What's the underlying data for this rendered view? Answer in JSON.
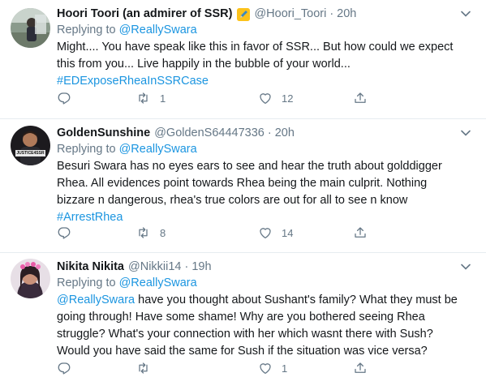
{
  "tweets": [
    {
      "name": "Hoori Toori (an admirer of SSR)",
      "has_badge": true,
      "handle": "@Hoori_Toori",
      "time": "20h",
      "replying_label": "Replying to",
      "replying_to": "@ReallySwara",
      "lines": [
        "Might.... You have speak like this in favor of SSR... But how could we  expect",
        "this from you... Live happily in the bubble of your world..."
      ],
      "hashtag": "#EDExposeRheaInSSRCase",
      "retweets": "1",
      "likes": "12",
      "avatar_icon": "person-photo-icon"
    },
    {
      "name": "GoldenSunshine",
      "handle": "@GoldenS64447336",
      "time": "20h",
      "replying_label": "Replying to",
      "replying_to": "@ReallySwara",
      "lines": [
        "Besuri Swara has no eyes ears to see and hear the truth about golddigger",
        "Rhea.  All evidences point towards Rhea being the main culprit.  Nothing",
        "bizzare n dangerous, rhea's true colors are out for all to see n know"
      ],
      "hashtag": "#ArrestRhea",
      "avatar_text": "JUSTICE4SSR",
      "retweets": "8",
      "likes": "14"
    },
    {
      "name": "Nikita Nikita",
      "handle": "@Nikkii14",
      "time": "19h",
      "replying_label": "Replying to",
      "replying_to": "@ReallySwara",
      "mention": "@ReallySwara",
      "first_line_rest": " have you thought about Sushant's family? What they must be",
      "lines": [
        "going through! Have some shame! Why are you bothered seeing Rhea",
        "struggle? What's your connection with her which wasnt there with Sush?",
        "Would you have said the same for Sush if the situation was vice versa?"
      ],
      "retweets": "",
      "likes": "1"
    }
  ],
  "colors": {
    "link": "#1b95e0",
    "muted": "#657786",
    "text": "#14171a",
    "divider": "#e6ecf0"
  },
  "icons": {
    "reply": "reply-bubble-icon",
    "retweet": "retweet-icon",
    "like": "heart-icon",
    "share": "share-icon",
    "more": "chevron-down-icon"
  }
}
